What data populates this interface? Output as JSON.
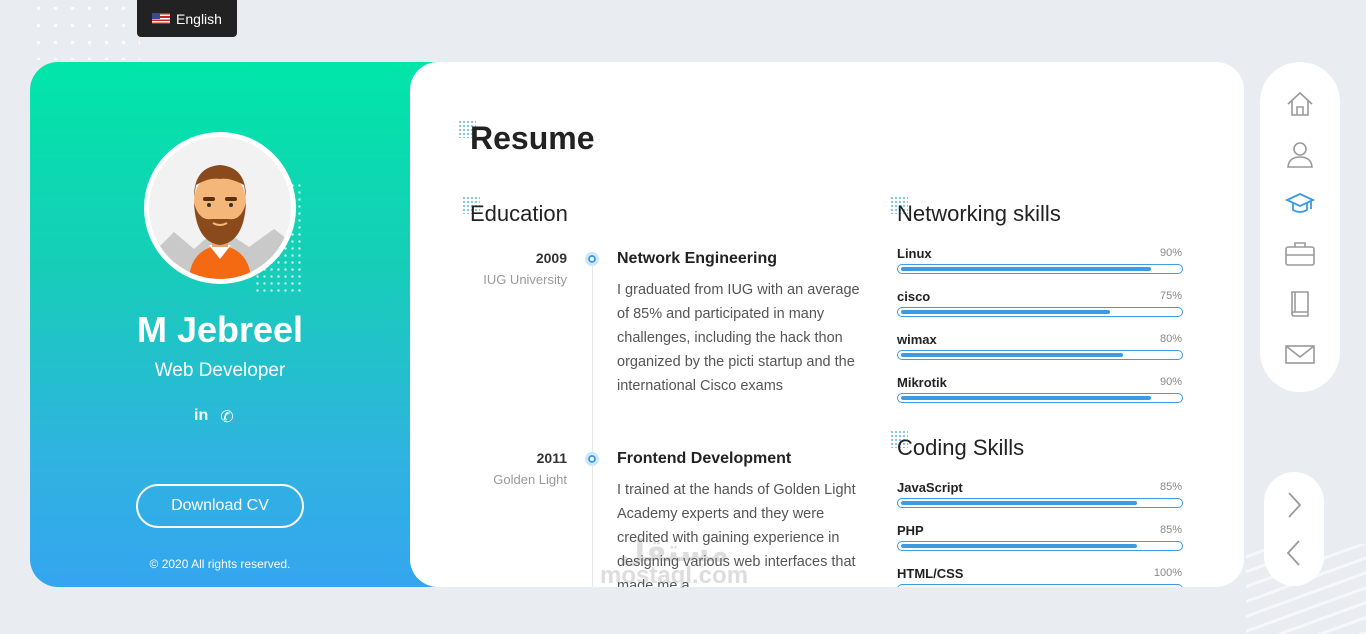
{
  "lang": {
    "label": "English"
  },
  "profile": {
    "name": "M Jebreel",
    "role": "Web Developer",
    "download_label": "Download CV",
    "copyright": "© 2020 All rights reserved."
  },
  "socials": {
    "linkedin": "in",
    "whatsapp": "✆"
  },
  "resume": {
    "title": "Resume",
    "education_title": "Education",
    "education": [
      {
        "year": "2009",
        "place": "IUG University",
        "title": "Network Engineering",
        "desc": "I graduated from IUG with an average of 85% and participated in many challenges, including the hack thon organized by the picti startup and the international Cisco exams"
      },
      {
        "year": "2011",
        "place": "Golden Light",
        "title": "Frontend Development",
        "desc": "I trained at the hands of Golden Light Academy experts and they were credited with gaining experience in designing various web interfaces that made me a"
      }
    ],
    "networking_title": "Networking skills",
    "networking": [
      {
        "name": "Linux",
        "pct": "90%",
        "value": 0.9
      },
      {
        "name": "cisco",
        "pct": "75%",
        "value": 0.75
      },
      {
        "name": "wimax",
        "pct": "80%",
        "value": 0.8
      },
      {
        "name": "Mikrotik",
        "pct": "90%",
        "value": 0.9
      }
    ],
    "coding_title": "Coding Skills",
    "coding": [
      {
        "name": "JavaScript",
        "pct": "85%",
        "value": 0.85
      },
      {
        "name": "PHP",
        "pct": "85%",
        "value": 0.85
      },
      {
        "name": "HTML/CSS",
        "pct": "100%",
        "value": 1.0
      }
    ]
  },
  "watermark": {
    "ar": "مستقل",
    "en": "mostaql.com"
  },
  "nav": {
    "items": [
      {
        "icon": "home-icon"
      },
      {
        "icon": "user-icon"
      },
      {
        "icon": "graduation-cap-icon",
        "active": true
      },
      {
        "icon": "briefcase-icon"
      },
      {
        "icon": "book-icon"
      },
      {
        "icon": "mail-icon"
      }
    ],
    "active_color": "#3d9be4",
    "icon_color": "#9a9a9a"
  },
  "colors": {
    "accent": "#3d9be4",
    "gradient_top": "#00e6a8",
    "gradient_bottom": "#35a5ef"
  }
}
